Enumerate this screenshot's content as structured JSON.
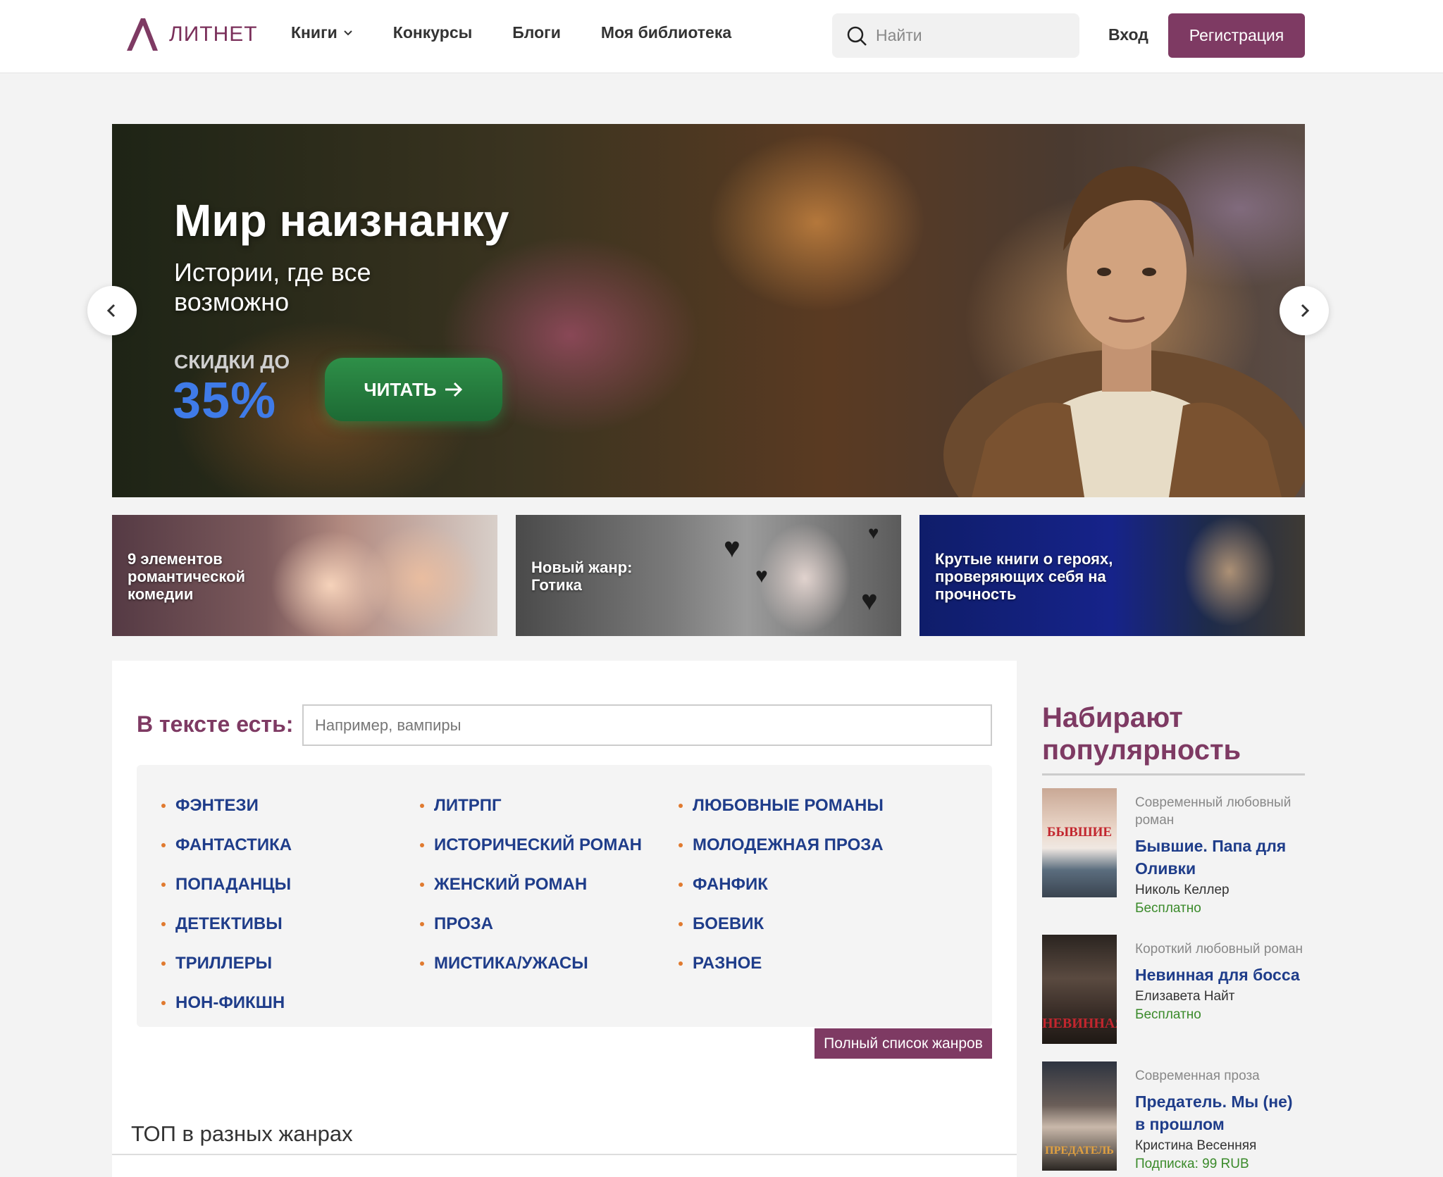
{
  "header": {
    "logo_text": "ЛИТНЕТ",
    "nav": [
      {
        "label": "Книги",
        "has_dropdown": true
      },
      {
        "label": "Конкурсы"
      },
      {
        "label": "Блоги"
      },
      {
        "label": "Моя библиотека"
      }
    ],
    "search_placeholder": "Найти",
    "login_label": "Вход",
    "register_label": "Регистрация"
  },
  "hero": {
    "title": "Мир наизнанку",
    "subtitle": "Истории, где все возможно",
    "discount_label": "СКИДКИ ДО",
    "discount_value": "35%",
    "button_label": "ЧИТАТЬ"
  },
  "promos": [
    {
      "text": "9 элементов романтической комедии"
    },
    {
      "text": "Новый жанр: Готика"
    },
    {
      "text": "Крутые книги о героях, проверяющих себя на прочность"
    }
  ],
  "filter": {
    "label": "В тексте есть:",
    "placeholder": "Например, вампиры"
  },
  "genres": {
    "col1": [
      "ФЭНТЕЗИ",
      "ФАНТАСТИКА",
      "ПОПАДАНЦЫ",
      "ДЕТЕКТИВЫ",
      "ТРИЛЛЕРЫ",
      "НОН-ФИКШН"
    ],
    "col2": [
      "ЛИТРПГ",
      "ИСТОРИЧЕСКИЙ РОМАН",
      "ЖЕНСКИЙ РОМАН",
      "ПРОЗА",
      "МИСТИКА/УЖАСЫ"
    ],
    "col3": [
      "ЛЮБОВНЫЕ РОМАНЫ",
      "МОЛОДЕЖНАЯ ПРОЗА",
      "ФАНФИК",
      "БОЕВИК",
      "РАЗНОЕ"
    ]
  },
  "full_list_label": "Полный список жанров",
  "top_title": "ТОП в разных жанрах",
  "sidebar": {
    "title": "Набирают популярность",
    "books": [
      {
        "genre": "Современный любовный роман",
        "title": "Бывшие. Папа для Оливки",
        "author": "Николь Келлер",
        "price": "Бесплатно",
        "cover_text": "БЫВШИЕ"
      },
      {
        "genre": "Короткий любовный роман",
        "title": "Невинная для босса",
        "author": "Елизавета Найт",
        "price": "Бесплатно",
        "cover_text": "НЕВИННАЯ"
      },
      {
        "genre": "Современная проза",
        "title": "Предатель. Мы (не) в прошлом",
        "author": "Кристина Весенняя",
        "price": "Подписка: 99 RUB",
        "cover_text": "ПРЕДАТЕЛЬ"
      }
    ]
  },
  "colors": {
    "brand": "#7e3a63",
    "link": "#1f3d8a",
    "bullet": "#e07a2f",
    "price": "#3a8a2a"
  }
}
